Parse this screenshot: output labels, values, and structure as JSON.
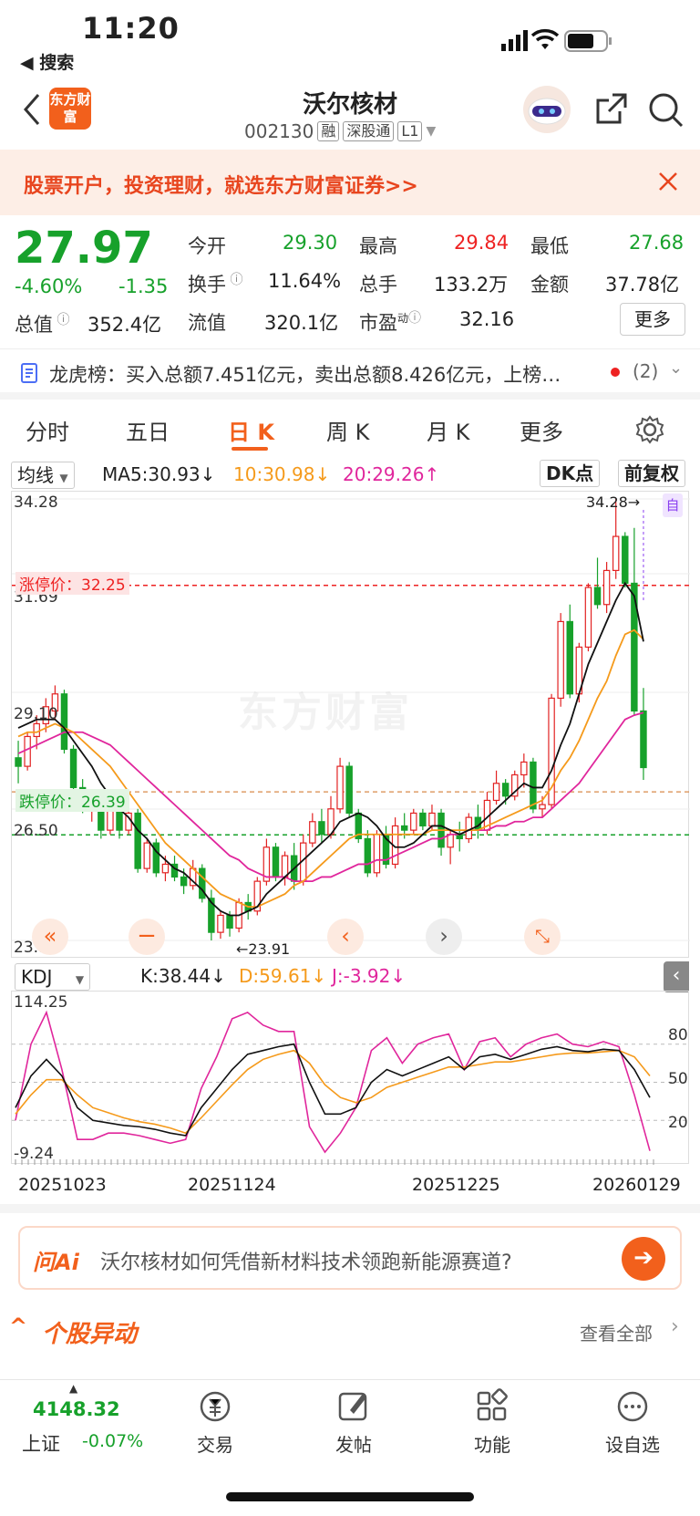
{
  "status": {
    "time": "11:20",
    "back_app": "◀ 搜索"
  },
  "header": {
    "title": "沃尔核材",
    "code": "002130",
    "tags": [
      "融",
      "深股通",
      "L1"
    ],
    "logo_text": "东方财富"
  },
  "banner": {
    "text": "股票开户，投资理财，就选东方财富证券>>"
  },
  "quote": {
    "price": "27.97",
    "change_pct": "-4.60%",
    "change": "-1.35",
    "open_label": "今开",
    "open": "29.30",
    "high_label": "最高",
    "high": "29.84",
    "low_label": "最低",
    "low": "27.68",
    "turnover_label": "换手",
    "turnover": "11.64%",
    "volume_label": "总手",
    "volume": "133.2万",
    "amount_label": "金额",
    "amount": "37.78亿",
    "mktcap_label": "总值",
    "mktcap": "352.4亿",
    "float_label": "流值",
    "float": "320.1亿",
    "pe_label": "市盈",
    "pe_sup": "动",
    "pe": "32.16",
    "more": "更多"
  },
  "lhb": {
    "text": "龙虎榜：买入总额7.451亿元，卖出总额8.426亿元，上榜…",
    "count": "(2)"
  },
  "tabs": [
    "分时",
    "五日",
    "日 K",
    "周 K",
    "月 K",
    "更多"
  ],
  "active_tab": "日 K",
  "ma_row": {
    "select": "均线",
    "ma5": "MA5:30.93↓",
    "ma10": "10:30.98↓",
    "ma20": "20:29.26↑",
    "dk": "DK点",
    "fq": "前复权"
  },
  "kchart": {
    "y_labels": [
      "34.28",
      "31.69",
      "29.10",
      "26.50",
      "23.91"
    ],
    "limit_up": "涨停价：32.25",
    "limit_down": "跌停价：26.39",
    "max_note": "34.28→",
    "min_note": "←23.91",
    "self_tag": "自",
    "watermark": "东方财富"
  },
  "kdj_row": {
    "select": "KDJ",
    "k": "K:38.44↓",
    "d": "D:59.61↓",
    "j": "J:-3.92↓"
  },
  "kdj": {
    "y_top": "114.25",
    "y_bottom": "-9.24",
    "levels": [
      "80",
      "50",
      "20"
    ]
  },
  "dates": [
    "20251023",
    "20251124",
    "20251225",
    "20260129"
  ],
  "ai": {
    "logo": "问Ai",
    "text": "沃尔核材如何凭借新材料技术领跑新能源赛道?"
  },
  "anomaly": {
    "title": "个股异动",
    "more": "查看全部"
  },
  "bottom": {
    "index_value": "4148.32",
    "index_name": "上证",
    "index_change": "-0.07%",
    "nav": [
      "交易",
      "发帖",
      "功能",
      "设自选"
    ]
  },
  "colors": {
    "accent": "#f2601c",
    "up": "#e22222",
    "down": "#17a12b",
    "ma10": "#f59a1b",
    "ma20": "#e0269c"
  },
  "chart_data": {
    "type": "candlestick",
    "title": "",
    "ylim": [
      23.91,
      34.28
    ],
    "series": [
      {
        "name": "MA5",
        "last": 30.93
      },
      {
        "name": "MA10",
        "last": 30.98
      },
      {
        "name": "MA20",
        "last": 29.26
      }
    ],
    "ohlc": [
      [
        28.2,
        28.6,
        27.6,
        28.0
      ],
      [
        28.0,
        28.8,
        27.9,
        28.7
      ],
      [
        28.7,
        29.2,
        28.4,
        29.0
      ],
      [
        29.0,
        29.6,
        28.8,
        29.4
      ],
      [
        29.3,
        29.9,
        29.1,
        29.7
      ],
      [
        29.7,
        29.8,
        28.3,
        28.4
      ],
      [
        28.4,
        28.5,
        27.4,
        27.5
      ],
      [
        27.5,
        27.7,
        26.9,
        27.0
      ],
      [
        27.0,
        27.3,
        26.7,
        27.2
      ],
      [
        27.2,
        27.4,
        26.3,
        26.5
      ],
      [
        26.5,
        27.2,
        26.4,
        27.0
      ],
      [
        27.0,
        27.1,
        26.3,
        26.5
      ],
      [
        26.5,
        27.1,
        26.4,
        26.9
      ],
      [
        26.9,
        27.0,
        25.5,
        25.6
      ],
      [
        25.6,
        26.3,
        25.5,
        26.2
      ],
      [
        26.2,
        26.3,
        25.4,
        25.5
      ],
      [
        25.5,
        25.9,
        25.3,
        25.7
      ],
      [
        25.7,
        25.9,
        25.3,
        25.4
      ],
      [
        25.4,
        25.6,
        25.0,
        25.2
      ],
      [
        25.2,
        25.8,
        25.1,
        25.6
      ],
      [
        25.6,
        25.7,
        24.8,
        24.9
      ],
      [
        24.9,
        25.1,
        23.91,
        24.1
      ],
      [
        24.1,
        24.6,
        23.95,
        24.5
      ],
      [
        24.5,
        24.6,
        24.0,
        24.2
      ],
      [
        24.2,
        24.9,
        24.1,
        24.8
      ],
      [
        24.8,
        25.0,
        24.4,
        24.6
      ],
      [
        24.6,
        25.4,
        24.5,
        25.3
      ],
      [
        25.3,
        26.3,
        25.2,
        26.1
      ],
      [
        26.1,
        26.2,
        25.3,
        25.4
      ],
      [
        25.4,
        26.0,
        25.2,
        25.9
      ],
      [
        25.9,
        26.2,
        25.1,
        25.3
      ],
      [
        25.3,
        26.4,
        25.2,
        26.2
      ],
      [
        26.2,
        26.9,
        26.1,
        26.7
      ],
      [
        26.7,
        27.0,
        26.2,
        26.4
      ],
      [
        26.4,
        27.3,
        26.3,
        27.0
      ],
      [
        27.0,
        28.2,
        26.9,
        28.0
      ],
      [
        28.0,
        28.1,
        26.8,
        26.9
      ],
      [
        26.9,
        27.0,
        26.2,
        26.3
      ],
      [
        26.3,
        26.5,
        25.4,
        25.5
      ],
      [
        25.5,
        26.5,
        25.4,
        26.4
      ],
      [
        26.4,
        26.6,
        25.6,
        25.7
      ],
      [
        25.7,
        26.8,
        25.6,
        26.6
      ],
      [
        26.6,
        26.9,
        26.3,
        26.5
      ],
      [
        26.5,
        27.0,
        26.4,
        26.9
      ],
      [
        26.9,
        27.0,
        26.5,
        26.6
      ],
      [
        26.6,
        27.1,
        26.5,
        26.9
      ],
      [
        26.9,
        27.0,
        25.9,
        26.1
      ],
      [
        26.1,
        26.5,
        25.7,
        26.4
      ],
      [
        26.4,
        26.7,
        26.0,
        26.3
      ],
      [
        26.3,
        26.9,
        26.2,
        26.8
      ],
      [
        26.8,
        27.1,
        26.3,
        26.5
      ],
      [
        26.5,
        27.4,
        26.4,
        27.2
      ],
      [
        27.2,
        27.9,
        27.1,
        27.6
      ],
      [
        27.6,
        27.7,
        27.1,
        27.3
      ],
      [
        27.3,
        27.9,
        27.2,
        27.8
      ],
      [
        27.8,
        28.3,
        27.5,
        28.1
      ],
      [
        28.1,
        28.2,
        26.9,
        27.0
      ],
      [
        27.0,
        27.3,
        26.8,
        27.1
      ],
      [
        27.1,
        29.7,
        27.0,
        29.6
      ],
      [
        29.6,
        31.6,
        29.4,
        31.4
      ],
      [
        31.4,
        31.8,
        29.6,
        29.7
      ],
      [
        29.7,
        30.9,
        29.5,
        30.8
      ],
      [
        30.8,
        32.3,
        30.7,
        32.2
      ],
      [
        32.2,
        32.9,
        31.7,
        31.8
      ],
      [
        31.8,
        32.8,
        31.6,
        32.6
      ],
      [
        32.6,
        34.28,
        32.4,
        33.4
      ],
      [
        33.4,
        33.5,
        32.2,
        32.3
      ],
      [
        32.3,
        33.6,
        29.2,
        29.3
      ],
      [
        29.3,
        29.84,
        27.68,
        27.97
      ]
    ],
    "ma5": [
      28.9,
      29.0,
      29.1,
      29.1,
      29.1,
      28.9,
      28.6,
      28.3,
      28.0,
      27.6,
      27.3,
      27.0,
      26.8,
      26.5,
      26.3,
      26.0,
      25.8,
      25.6,
      25.5,
      25.3,
      25.1,
      24.8,
      24.6,
      24.5,
      24.5,
      24.6,
      24.7,
      25.0,
      25.2,
      25.4,
      25.6,
      25.8,
      26.0,
      26.2,
      26.4,
      26.7,
      26.8,
      26.9,
      26.8,
      26.6,
      26.3,
      26.1,
      26.1,
      26.2,
      26.4,
      26.6,
      26.6,
      26.5,
      26.4,
      26.5,
      26.6,
      26.8,
      27.0,
      27.2,
      27.4,
      27.6,
      27.5,
      27.5,
      27.9,
      28.5,
      29.0,
      29.7,
      30.4,
      30.9,
      31.4,
      31.9,
      32.3,
      32.0,
      30.93
    ],
    "ma10": [
      28.7,
      28.8,
      28.8,
      28.9,
      29.0,
      28.9,
      28.8,
      28.6,
      28.4,
      28.2,
      28.0,
      27.7,
      27.4,
      27.1,
      26.8,
      26.5,
      26.2,
      26.0,
      25.8,
      25.6,
      25.4,
      25.2,
      25.0,
      24.9,
      24.8,
      24.7,
      24.7,
      24.8,
      24.9,
      25.0,
      25.2,
      25.3,
      25.5,
      25.7,
      25.9,
      26.1,
      26.3,
      26.4,
      26.4,
      26.4,
      26.4,
      26.4,
      26.4,
      26.4,
      26.4,
      26.5,
      26.5,
      26.5,
      26.5,
      26.5,
      26.5,
      26.6,
      26.7,
      26.8,
      26.9,
      27.0,
      27.1,
      27.2,
      27.5,
      27.9,
      28.2,
      28.6,
      29.1,
      29.6,
      30.0,
      30.6,
      31.1,
      31.2,
      30.98
    ],
    "ma20": [
      28.3,
      28.4,
      28.5,
      28.6,
      28.7,
      28.8,
      28.8,
      28.8,
      28.7,
      28.6,
      28.5,
      28.3,
      28.1,
      27.9,
      27.7,
      27.5,
      27.3,
      27.1,
      26.9,
      26.7,
      26.5,
      26.3,
      26.1,
      25.9,
      25.8,
      25.6,
      25.5,
      25.4,
      25.4,
      25.4,
      25.3,
      25.3,
      25.3,
      25.4,
      25.4,
      25.5,
      25.6,
      25.7,
      25.7,
      25.8,
      25.8,
      25.9,
      26.0,
      26.1,
      26.2,
      26.3,
      26.3,
      26.4,
      26.4,
      26.5,
      26.5,
      26.5,
      26.6,
      26.6,
      26.7,
      26.7,
      26.8,
      26.8,
      27.0,
      27.2,
      27.4,
      27.6,
      27.9,
      28.2,
      28.5,
      28.8,
      29.1,
      29.2,
      29.26
    ],
    "limit_up": 32.25,
    "limit_down": 26.39,
    "reference_line": 27.4,
    "kdj": {
      "ylim": [
        -9.24,
        114.25
      ],
      "k": [
        30,
        55,
        68,
        55,
        30,
        20,
        18,
        16,
        15,
        13,
        10,
        8,
        30,
        45,
        60,
        72,
        75,
        78,
        80,
        50,
        25,
        25,
        30,
        50,
        60,
        55,
        60,
        65,
        70,
        60,
        70,
        72,
        68,
        72,
        76,
        78,
        75,
        74,
        76,
        75,
        60,
        38
      ],
      "d": [
        25,
        40,
        52,
        52,
        40,
        30,
        26,
        22,
        19,
        17,
        14,
        10,
        22,
        35,
        48,
        60,
        68,
        72,
        75,
        65,
        48,
        38,
        34,
        38,
        46,
        50,
        54,
        58,
        62,
        62,
        64,
        66,
        66,
        68,
        70,
        72,
        73,
        73,
        74,
        75,
        70,
        55
      ],
      "j": [
        20,
        80,
        105,
        60,
        5,
        5,
        10,
        10,
        8,
        5,
        2,
        5,
        45,
        70,
        100,
        105,
        95,
        90,
        90,
        15,
        -5,
        10,
        30,
        75,
        85,
        65,
        80,
        85,
        88,
        60,
        82,
        85,
        70,
        80,
        85,
        88,
        80,
        78,
        82,
        78,
        40,
        -4
      ]
    }
  }
}
